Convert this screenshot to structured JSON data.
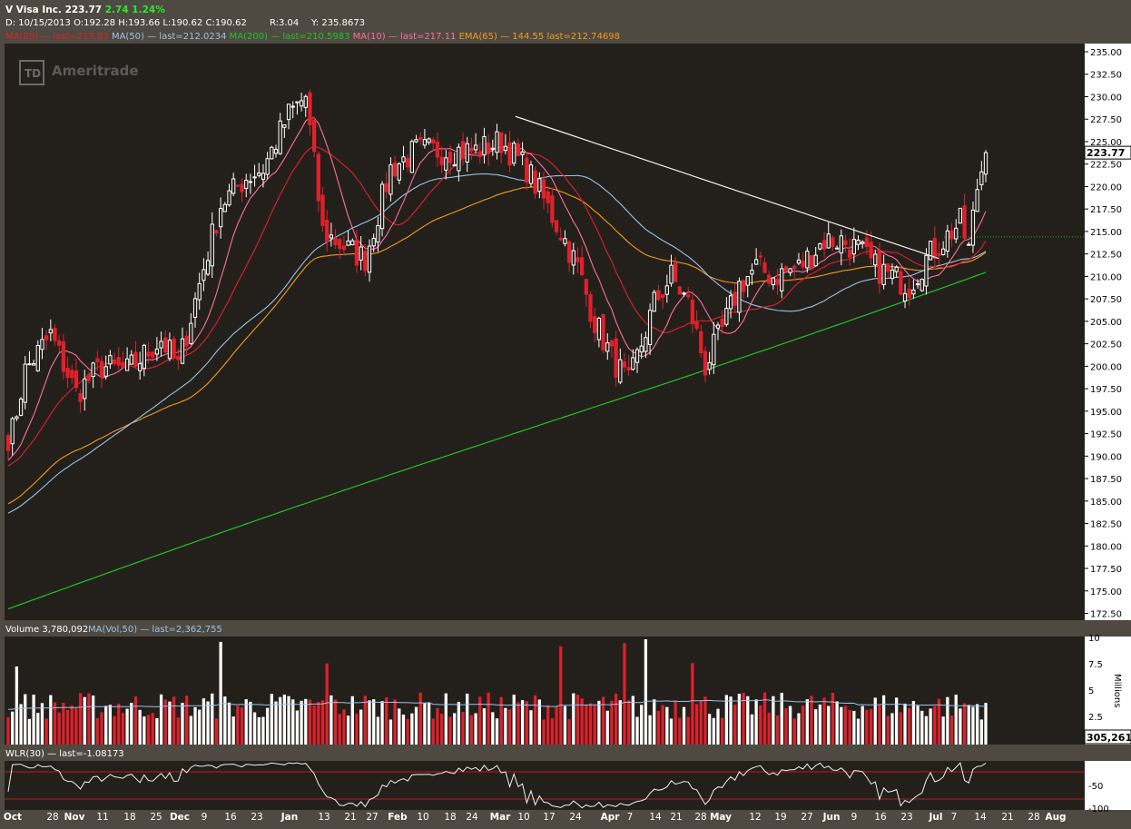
{
  "header": {
    "symbol": "V",
    "name": "Visa Inc.",
    "last": "223.77",
    "change": "2.74",
    "change_pct": "1.24%",
    "line2": "D: 10/15/2013  O:192.28  H:193.66  L:190.62  C:190.62",
    "range": "R:3.04",
    "y_readout": "Y: 235.8673"
  },
  "indicators": [
    {
      "label": "MA(20)",
      "value": "last=213.83",
      "color": "#e0202a"
    },
    {
      "label": "MA(50)",
      "value": "last=212.0234",
      "color": "#9cc1e6"
    },
    {
      "label": "MA(200)",
      "value": "last=210.5983",
      "color": "#23c123"
    },
    {
      "label": "MA(10)",
      "value": "last=217.11",
      "color": "#ff6f9a"
    },
    {
      "label": "EMA(65)",
      "value": "144.55 last=212.74698",
      "color": "#f39a20"
    }
  ],
  "watermark": "Ameritrade",
  "watermark_badge": "TD",
  "price_panel": {
    "last_label": "223.77",
    "yticks": [
      "235.00",
      "232.50",
      "230.00",
      "227.50",
      "225.00",
      "222.50",
      "220.00",
      "217.50",
      "215.00",
      "212.50",
      "210.00",
      "207.50",
      "205.00",
      "202.50",
      "200.00",
      "197.50",
      "195.00",
      "192.50",
      "190.00",
      "187.50",
      "185.00",
      "182.50",
      "180.00",
      "177.50",
      "175.00",
      "172.50"
    ]
  },
  "volume_panel": {
    "title": "Volume 3,780,092",
    "ma_label": "MA(Vol,50)",
    "ma_value": "last=2,362,755",
    "unit": "Millions",
    "yticks": [
      "10",
      "7.5",
      "5",
      "2.5"
    ],
    "last_label": "305,261"
  },
  "wlr_panel": {
    "title": "WLR(30)",
    "value": "last=-1.08173",
    "yticks": [
      "-50",
      "-100"
    ]
  },
  "xaxis": {
    "labels": [
      "Oct",
      "28",
      "Nov",
      "11",
      "18",
      "25",
      "Dec",
      "9",
      "16",
      "23",
      "Jan",
      "13",
      "21",
      "27",
      "Feb",
      "10",
      "18",
      "24",
      "Mar",
      "10",
      "17",
      "24",
      "Apr",
      "7",
      "14",
      "21",
      "28",
      "May",
      "12",
      "19",
      "27",
      "Jun",
      "9",
      "16",
      "23",
      "Jul",
      "7",
      "14",
      "21",
      "28",
      "Aug"
    ]
  },
  "colors": {
    "up": "#ffffff",
    "down": "#e0202a",
    "panel_bg": "#23201c",
    "frame": "#4e4a42",
    "trendline": "#f0f0f0",
    "current_price_line": "#1db31d"
  },
  "chart_data": {
    "type": "candlestick",
    "title": "V Visa Inc.",
    "x_start_date": "2013-10-15",
    "x_end_date": "2014-07-17",
    "ylim": [
      172.0,
      236.5
    ],
    "xlim": [
      "2013-10-01",
      "2014-08-05"
    ],
    "ohlc": [],
    "trendline": {
      "from": [
        "2014-03-10",
        227.8
      ],
      "to": [
        "2014-07-01",
        212.0
      ]
    },
    "current_price_line": 214.4,
    "moving_averages": [
      {
        "name": "MA(20)",
        "last": 213.83
      },
      {
        "name": "MA(50)",
        "last": 212.0234
      },
      {
        "name": "MA(200)",
        "last": 210.5983
      },
      {
        "name": "MA(10)",
        "last": 217.11
      },
      {
        "name": "EMA(65)",
        "last": 212.74698
      }
    ],
    "volume": {
      "ylim": [
        0,
        10
      ],
      "unit": "Millions",
      "ma50_last": 2.362755,
      "last": 3.780092
    },
    "wlr": {
      "ylim": [
        -100,
        0
      ],
      "last": -1.08173,
      "levels": [
        -20,
        -80
      ]
    }
  }
}
